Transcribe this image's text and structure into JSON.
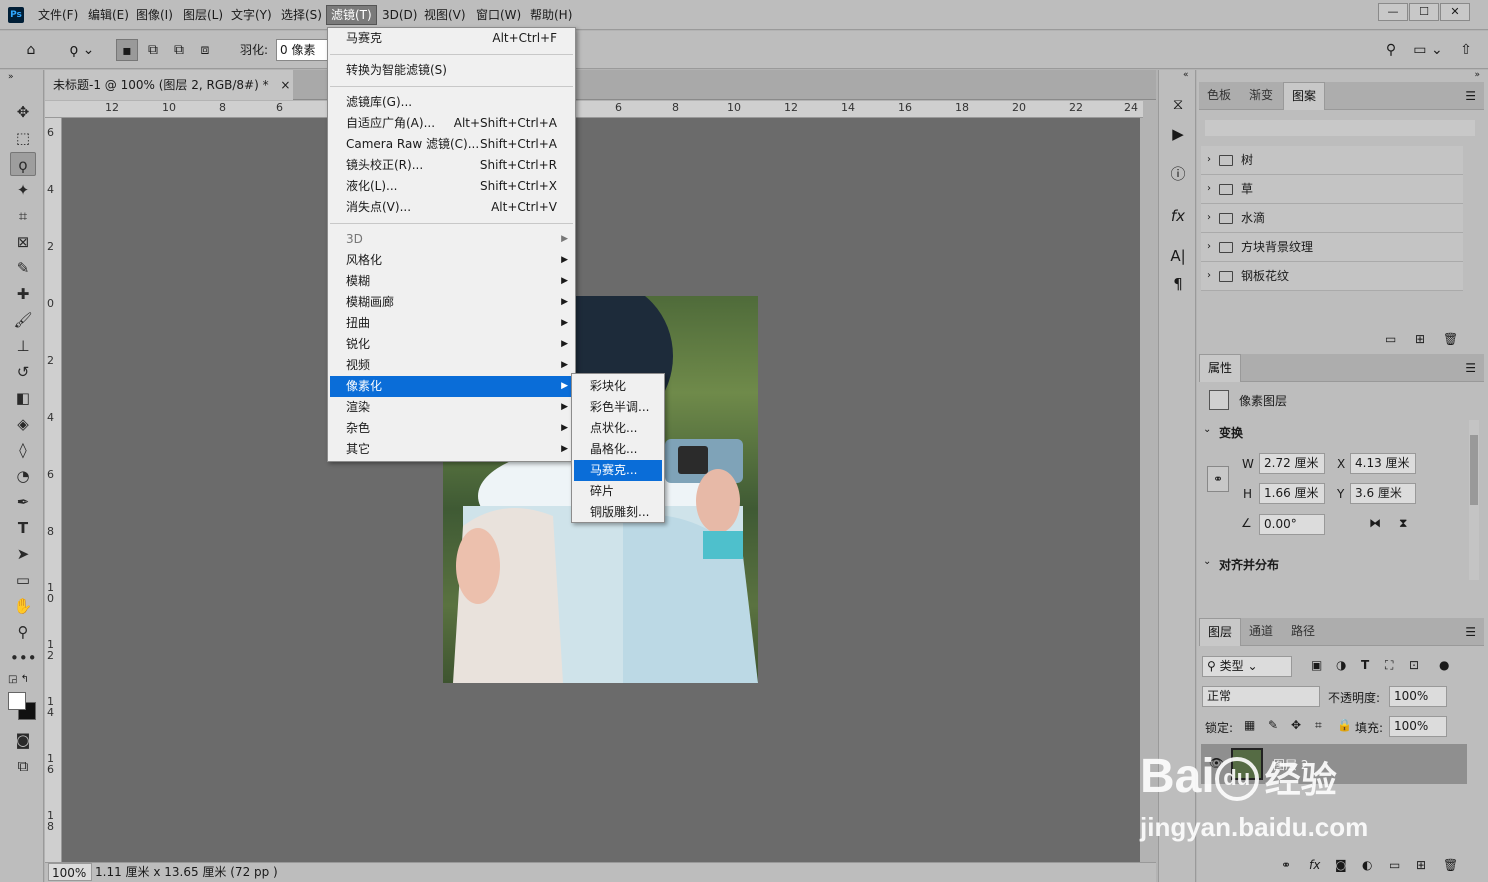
{
  "app": {
    "logo": "Ps"
  },
  "menubar": {
    "items": [
      "文件(F)",
      "编辑(E)",
      "图像(I)",
      "图层(L)",
      "文字(Y)",
      "选择(S)",
      "滤镜(T)",
      "3D(D)",
      "视图(V)",
      "窗口(W)",
      "帮助(H)"
    ],
    "window_buttons": [
      "—",
      "☐",
      "✕"
    ]
  },
  "options": {
    "feather_label": "羽化:",
    "feather_value": "0 像素"
  },
  "document": {
    "tab_title": "未标题-1 @ 100% (图层 2, RGB/8#) *",
    "close": "×",
    "ruler_h": [
      "12",
      "10",
      "8",
      "6",
      "6",
      "8",
      "10",
      "12",
      "14",
      "16",
      "18",
      "20",
      "22",
      "24"
    ],
    "ruler_v": [
      "6",
      "4",
      "2",
      "0",
      "2",
      "4",
      "6",
      "8",
      "1 0",
      "1 2",
      "1 4",
      "1 6",
      "1 8"
    ]
  },
  "status": {
    "zoom": "100%",
    "info": "1.11 厘米 x 13.65 厘米 (72 pp )",
    "arrow": "›"
  },
  "filter_menu": {
    "last_filter": {
      "label": "马赛克",
      "shortcut": "Alt+Ctrl+F"
    },
    "convert_smart": "转换为智能滤镜(S)",
    "group1": [
      {
        "label": "滤镜库(G)...",
        "shortcut": ""
      },
      {
        "label": "自适应广角(A)...",
        "shortcut": "Alt+Shift+Ctrl+A"
      },
      {
        "label": "Camera Raw 滤镜(C)...",
        "shortcut": "Shift+Ctrl+A"
      },
      {
        "label": "镜头校正(R)...",
        "shortcut": "Shift+Ctrl+R"
      },
      {
        "label": "液化(L)...",
        "shortcut": "Shift+Ctrl+X"
      },
      {
        "label": "消失点(V)...",
        "shortcut": "Alt+Ctrl+V"
      }
    ],
    "submenus": [
      "3D",
      "风格化",
      "模糊",
      "模糊画廊",
      "扭曲",
      "锐化",
      "视频",
      "像素化",
      "渲染",
      "杂色",
      "其它"
    ],
    "arrow": "▶"
  },
  "pixelate_submenu": [
    "彩块化",
    "彩色半调...",
    "点状化...",
    "晶格化...",
    "马赛克...",
    "碎片",
    "铜版雕刻..."
  ],
  "patterns_panel": {
    "tabs": [
      "色板",
      "渐变",
      "图案"
    ],
    "menu_icon": "☰",
    "folders": [
      "树",
      "草",
      "水滴",
      "方块背景纹理",
      "钢板花纹"
    ],
    "chevron": "›"
  },
  "properties_panel": {
    "tab": "属性",
    "layer_type": "像素图层",
    "transform_title": "变换",
    "w_label": "W",
    "w_value": "2.72 厘米",
    "x_label": "X",
    "x_value": "4.13 厘米",
    "h_label": "H",
    "h_value": "1.66 厘米",
    "y_label": "Y",
    "y_value": "3.6 厘米",
    "angle_value": "0.00°",
    "align_title": "对齐并分布",
    "chevron": "⌄"
  },
  "layers_panel": {
    "tabs": [
      "图层",
      "通道",
      "路径"
    ],
    "filter_type": "类型",
    "blend_mode": "正常",
    "opacity_label": "不透明度:",
    "opacity_value": "100%",
    "lock_label": "锁定:",
    "fill_label": "填充:",
    "fill_value": "100%",
    "layer_name": "图层 2"
  },
  "watermark": {
    "brand": "Bai",
    "brand_du": "du",
    "suffix": "经验",
    "url": "jingyan.baidu.com"
  },
  "colors": {
    "highlight": "#0a6dd8",
    "canvas": "#6b6b6b",
    "chrome": "#bdbdbd"
  }
}
